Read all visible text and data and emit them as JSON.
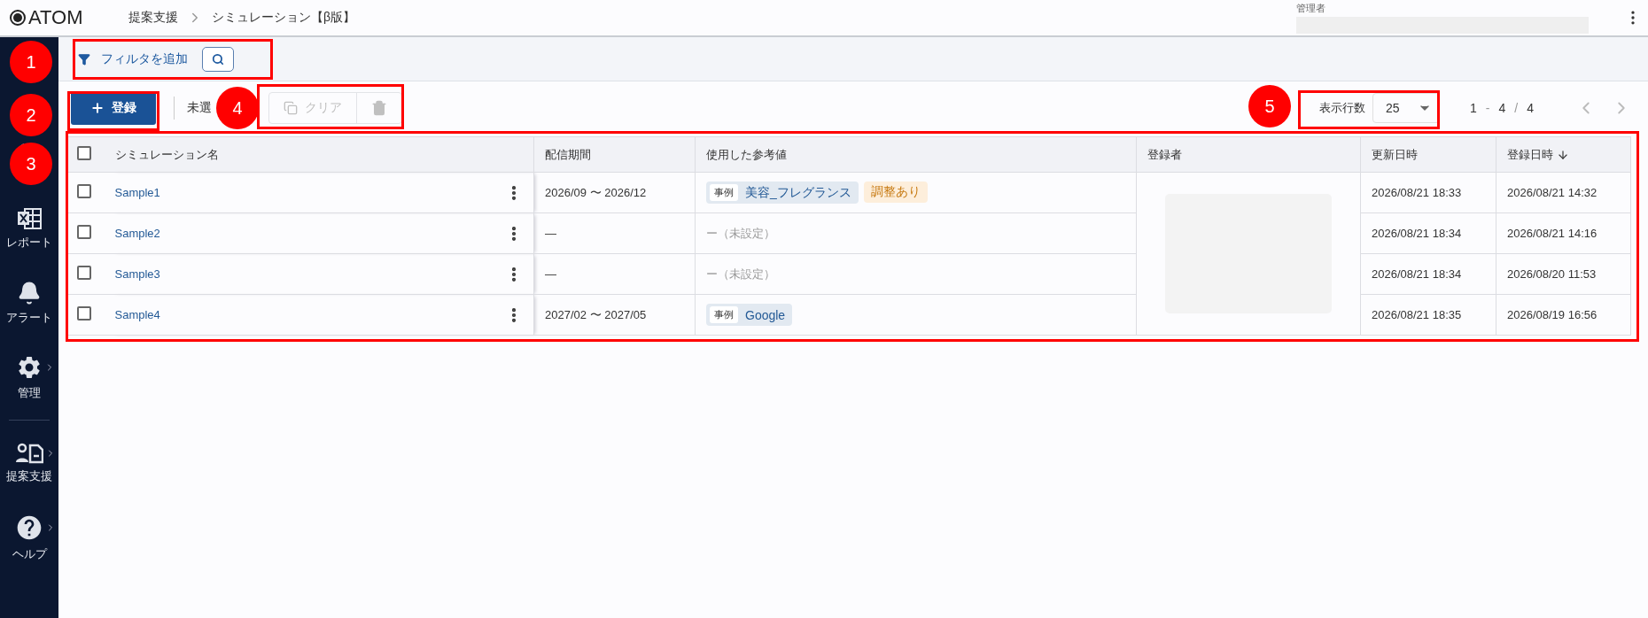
{
  "header": {
    "logo": "ATOM",
    "breadcrumb": [
      "提案支援",
      "シミュレーション【β版】"
    ],
    "user_role": "管理者"
  },
  "sidebar": {
    "items": [
      {
        "kind": "hidden"
      },
      {
        "kind": "progress"
      },
      {
        "kind": "report",
        "label": "レポート",
        "submenu": false
      },
      {
        "kind": "alert",
        "label": "アラート",
        "submenu": false
      },
      {
        "kind": "settings",
        "label": "管理",
        "submenu": true
      },
      {
        "kind": "divider"
      },
      {
        "kind": "proposal",
        "label": "提案支援",
        "submenu": true
      },
      {
        "kind": "help",
        "label": "ヘルプ",
        "submenu": true
      }
    ]
  },
  "filter": {
    "label": "フィルタを追加"
  },
  "toolbar": {
    "register_button": "登録",
    "selection_text": "未選",
    "clear_button": {
      "label": "クリア",
      "disabled": true
    },
    "delete_button": {
      "disabled": true
    }
  },
  "pagination": {
    "rows_label": "表示行数",
    "rows_value": "25",
    "range": [
      "1",
      "-",
      "4",
      "/",
      "4"
    ],
    "prev_disabled": true,
    "next_disabled": true
  },
  "table": {
    "header_checked": false,
    "columns": [
      {
        "label": "シミュレーション名"
      },
      {
        "label": "配信期間"
      },
      {
        "label": "使用した参考値"
      },
      {
        "label": "登録者"
      },
      {
        "label": "更新日時"
      },
      {
        "label": "登録日時",
        "sorted_descending": true
      }
    ],
    "rows": [
      {
        "checked": false,
        "name": "Sample1",
        "period": "2026/09 〜 2026/12",
        "refs": [
          {
            "kind": "tag",
            "tag": "事例",
            "value": "美容_フレグランス"
          },
          {
            "kind": "badge",
            "value": "調整あり"
          }
        ],
        "updated": "2026/08/21 18:33",
        "created": "2026/08/21 14:32"
      },
      {
        "checked": false,
        "name": "Sample2",
        "period": "—",
        "refs": [
          {
            "kind": "unset",
            "value": "ー（未設定）"
          }
        ],
        "updated": "2026/08/21 18:34",
        "created": "2026/08/21 14:16"
      },
      {
        "checked": false,
        "name": "Sample3",
        "period": "—",
        "refs": [
          {
            "kind": "unset",
            "value": "ー（未設定）"
          }
        ],
        "updated": "2026/08/21 18:34",
        "created": "2026/08/20 11:53"
      },
      {
        "checked": false,
        "name": "Sample4",
        "period": "2027/02 〜 2027/05",
        "refs": [
          {
            "kind": "tag",
            "tag": "事例",
            "value": "Google"
          }
        ],
        "updated": "2026/08/21 18:35",
        "created": "2026/08/19 16:56"
      }
    ]
  },
  "annotations": [
    {
      "label": "1"
    },
    {
      "label": "2"
    },
    {
      "label": "3"
    },
    {
      "label": "4"
    },
    {
      "label": "5"
    }
  ]
}
